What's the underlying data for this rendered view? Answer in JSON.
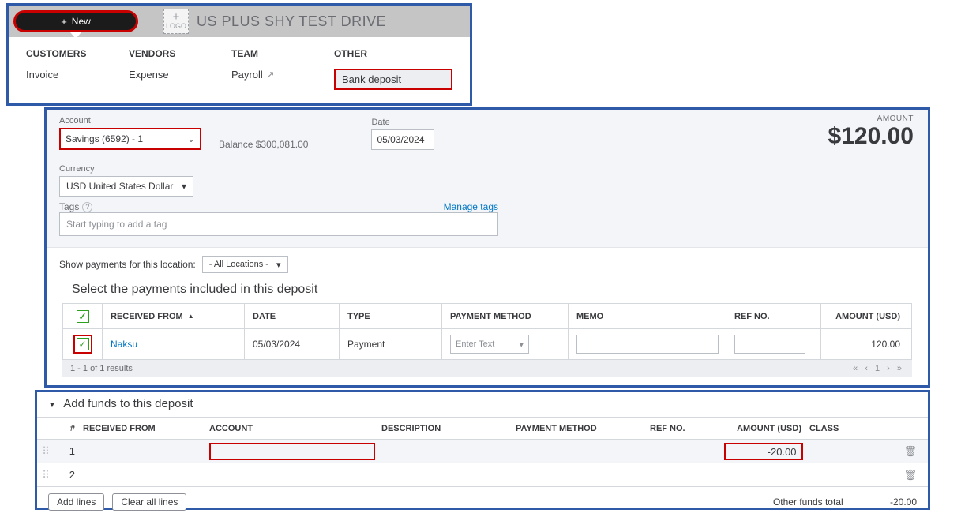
{
  "top": {
    "new_button": "New",
    "company_name": "US PLUS SHY TEST DRIVE",
    "columns": {
      "customers": {
        "header": "CUSTOMERS",
        "item": "Invoice"
      },
      "vendors": {
        "header": "VENDORS",
        "item": "Expense"
      },
      "team": {
        "header": "TEAM",
        "item": "Payroll"
      },
      "other": {
        "header": "OTHER",
        "item": "Bank deposit"
      }
    }
  },
  "form": {
    "account_label": "Account",
    "account_value": "Savings (6592) - 1",
    "balance_label": "Balance",
    "balance_value": "$300,081.00",
    "date_label": "Date",
    "date_value": "05/03/2024",
    "amount_label": "AMOUNT",
    "amount_value": "$120.00",
    "currency_label": "Currency",
    "currency_value": "USD United States Dollar",
    "tags_label": "Tags",
    "tags_placeholder": "Start typing to add a tag",
    "manage_tags": "Manage tags",
    "show_payments_label": "Show payments for this location:",
    "location_value": "- All Locations -"
  },
  "payments": {
    "heading": "Select the payments included in this deposit",
    "headers": {
      "from": "RECEIVED FROM",
      "date": "DATE",
      "type": "TYPE",
      "pm": "PAYMENT METHOD",
      "memo": "MEMO",
      "ref": "REF NO.",
      "amt": "AMOUNT (USD)"
    },
    "row": {
      "from": "Naksu",
      "date": "05/03/2024",
      "type": "Payment",
      "pm_placeholder": "Enter Text",
      "amount": "120.00"
    },
    "results_text": "1 - 1 of 1 results"
  },
  "addfunds": {
    "heading": "Add funds to this deposit",
    "headers": {
      "num": "#",
      "from": "RECEIVED FROM",
      "acct": "ACCOUNT",
      "desc": "DESCRIPTION",
      "pm": "PAYMENT METHOD",
      "ref": "REF NO.",
      "amt": "AMOUNT (USD)",
      "class": "CLASS"
    },
    "rows": [
      {
        "num": "1",
        "amount": "-20.00"
      },
      {
        "num": "2",
        "amount": ""
      }
    ],
    "add_lines": "Add lines",
    "clear_lines": "Clear all lines",
    "total_label": "Other funds total",
    "total_value": "-20.00"
  }
}
